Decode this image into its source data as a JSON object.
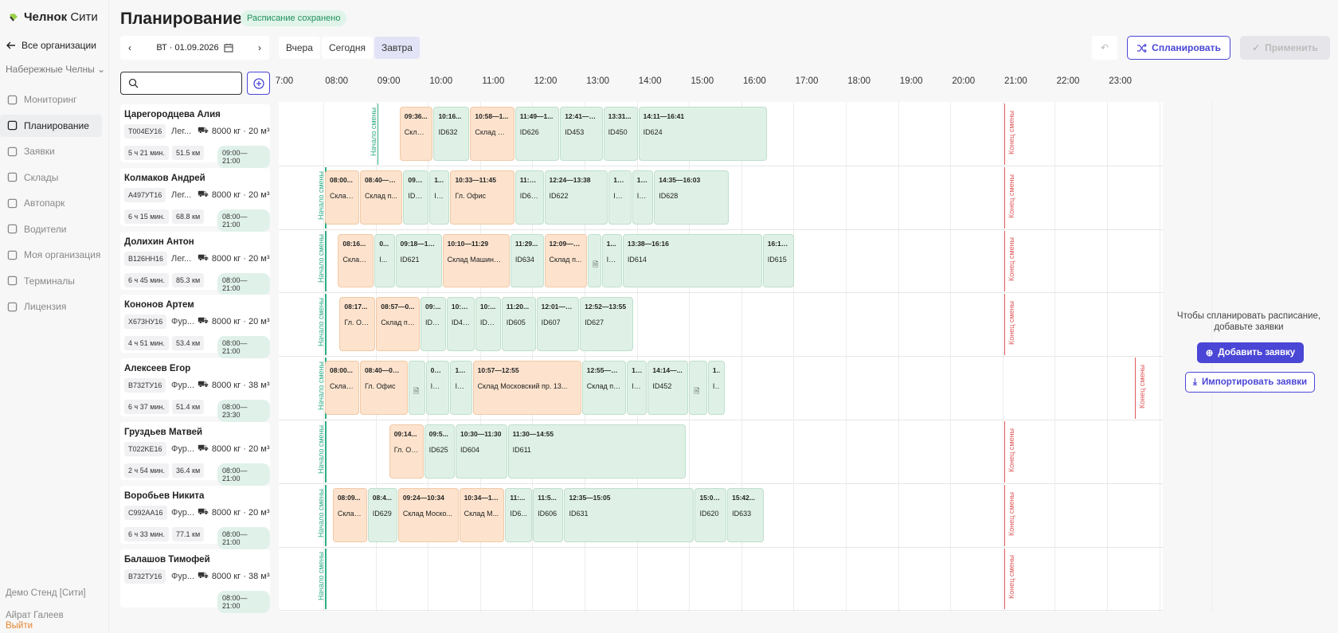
{
  "app": {
    "logo_text": "Челнок",
    "logo_suffix": "Сити",
    "back": "Все организации",
    "city": "Набережные Челны"
  },
  "nav": [
    {
      "label": "Мониторинг",
      "icon": "map-icon"
    },
    {
      "label": "Планирование",
      "icon": "calendar-icon",
      "active": true
    },
    {
      "label": "Заявки",
      "icon": "document-icon"
    },
    {
      "label": "Склады",
      "icon": "warehouse-icon"
    },
    {
      "label": "Автопарк",
      "icon": "truck-icon"
    },
    {
      "label": "Водители",
      "icon": "steering-icon"
    },
    {
      "label": "Моя организация",
      "icon": "gear-icon"
    },
    {
      "label": "Терминалы",
      "icon": "terminal-icon"
    },
    {
      "label": "Лицензия",
      "icon": "license-icon"
    }
  ],
  "footer": {
    "org": "Демо Стенд [Сити]",
    "user": "Айрат Галеев",
    "logout": "Выйти"
  },
  "header": {
    "title": "Планирование",
    "status": "Расписание сохранено",
    "date": "ВТ · 01.09.2026",
    "yesterday": "Вчера",
    "today": "Сегодня",
    "tomorrow": "Завтра",
    "plan": "Спланировать",
    "apply": "Применить"
  },
  "hours": [
    "7:00",
    "08:00",
    "09:00",
    "10:00",
    "11:00",
    "12:00",
    "13:00",
    "14:00",
    "15:00",
    "16:00",
    "17:00",
    "18:00",
    "19:00",
    "20:00",
    "21:00",
    "22:00",
    "23:00"
  ],
  "labels": {
    "start": "Начало смены",
    "end": "Конец смены"
  },
  "drivers": [
    {
      "name": "Царегородцева Алия",
      "plate": "T004EУ16",
      "type": "Лег...",
      "cap": "8000 кг · 20 м³",
      "dur": "5 ч 21 мин.",
      "km": "51.5 км",
      "shift": "09:00—21:00",
      "start": 9,
      "end": 21,
      "blocks": [
        [
          "w",
          9.43,
          10.08,
          "09:36...",
          "Склад..."
        ],
        [
          "g",
          10.08,
          10.78,
          "10:16...",
          "ID632"
        ],
        [
          "w",
          10.78,
          11.64,
          "10:58—1...",
          "Склад М..."
        ],
        [
          "g",
          11.64,
          12.5,
          "11:49—1...",
          "ID626"
        ],
        [
          "g",
          12.5,
          13.33,
          "12:41—1...",
          "ID453"
        ],
        [
          "g",
          13.33,
          14.0,
          "13:31...",
          "ID450"
        ],
        [
          "g",
          14.0,
          16.48,
          "14:11—16:41",
          "ID624"
        ]
      ]
    },
    {
      "name": "Колмаков Андрей",
      "plate": "A497УТ16",
      "type": "Лег...",
      "cap": "8000 кг · 20 м³",
      "dur": "6 ч 15 мин.",
      "km": "68.8 км",
      "shift": "08:00—21:00",
      "start": 8,
      "end": 21,
      "blocks": [
        [
          "w",
          8.0,
          8.67,
          "08:00...",
          "Склад..."
        ],
        [
          "w",
          8.67,
          9.5,
          "08:40—0...",
          "Склад п..."
        ],
        [
          "g",
          9.5,
          10.0,
          "09:29...",
          "ID616"
        ],
        [
          "g",
          10.0,
          10.4,
          "1...",
          "ID..."
        ],
        [
          "w",
          10.4,
          11.64,
          "10:33—11:45",
          "Гл. Офис"
        ],
        [
          "g",
          11.64,
          12.2,
          "11:45...",
          "ID623"
        ],
        [
          "g",
          12.2,
          13.43,
          "12:24—13:38",
          "ID622"
        ],
        [
          "g",
          13.43,
          13.88,
          "13:...",
          "ID4..."
        ],
        [
          "g",
          13.88,
          14.3,
          "14:...",
          "ID..."
        ],
        [
          "g",
          14.3,
          15.75,
          "14:35—16:03",
          "ID628"
        ]
      ]
    },
    {
      "name": "Долихин Антон",
      "plate": "B126HH16",
      "type": "Лег...",
      "cap": "8000 кг · 20 м³",
      "dur": "6 ч 45 мин.",
      "km": "85.3 км",
      "shift": "08:00—21:00",
      "start": 8,
      "end": 21,
      "blocks": [
        [
          "w",
          8.25,
          8.95,
          "08:16...",
          "Склад..."
        ],
        [
          "g",
          8.95,
          9.35,
          "0...",
          "I..."
        ],
        [
          "g",
          9.35,
          10.25,
          "09:18—10...",
          "ID621"
        ],
        [
          "w",
          10.25,
          11.55,
          "10:10—11:29",
          "Склад Машинос..."
        ],
        [
          "g",
          11.55,
          12.2,
          "11:29...",
          "ID634"
        ],
        [
          "w",
          12.2,
          13.03,
          "12:09—1...",
          "Склад п..."
        ],
        [
          "g",
          13.03,
          13.3,
          "",
          "doc"
        ],
        [
          "g",
          13.3,
          13.7,
          "1...",
          "ID..."
        ],
        [
          "g",
          13.7,
          16.38,
          "13:38—16:16",
          "ID614"
        ],
        [
          "g",
          16.38,
          17.0,
          "16:16...",
          "ID615"
        ]
      ]
    },
    {
      "name": "Кононов Артем",
      "plate": "X673HУ16",
      "type": "Фур...",
      "cap": "8000 кг · 20 м³",
      "dur": "4 ч 51 мин.",
      "km": "53.4 км",
      "shift": "08:00—21:00",
      "start": 8,
      "end": 21,
      "blocks": [
        [
          "w",
          8.28,
          8.98,
          "08:17...",
          "Гл. Оф..."
        ],
        [
          "w",
          8.98,
          9.83,
          "08:57—0...",
          "Склад пр..."
        ],
        [
          "g",
          9.83,
          10.33,
          "09:...",
          "ID6..."
        ],
        [
          "g",
          10.33,
          10.88,
          "10:1...",
          "ID451"
        ],
        [
          "g",
          10.88,
          11.38,
          "10:...",
          "ID6..."
        ],
        [
          "g",
          11.38,
          12.05,
          "11:20...",
          "ID605"
        ],
        [
          "g",
          12.05,
          12.88,
          "12:01—1...",
          "ID607"
        ],
        [
          "g",
          12.88,
          13.92,
          "12:52—13:55",
          "ID627"
        ]
      ]
    },
    {
      "name": "Алексеев Егор",
      "plate": "B732TУ16",
      "type": "Фур...",
      "cap": "8000 кг · 38 м³",
      "dur": "6 ч 37 мин.",
      "km": "51.4 км",
      "shift": "08:00—23:30",
      "start": 8,
      "end": 23.5,
      "blocks": [
        [
          "w",
          8.0,
          8.67,
          "08:00...",
          "Склад..."
        ],
        [
          "w",
          8.67,
          9.6,
          "08:40—09:...",
          "Гл. Офис"
        ],
        [
          "g",
          9.6,
          9.93,
          "",
          "doc"
        ],
        [
          "g",
          9.93,
          10.4,
          "09:...",
          "ID4..."
        ],
        [
          "g",
          10.4,
          10.83,
          "10:...",
          "ID6..."
        ],
        [
          "w",
          10.83,
          12.92,
          "10:57—12:55",
          "Склад Московский пр. 13..."
        ],
        [
          "g",
          12.92,
          13.78,
          "12:55—13...",
          "Склад пр..."
        ],
        [
          "g",
          13.78,
          14.18,
          "13...",
          "ID..."
        ],
        [
          "g",
          14.18,
          14.97,
          "14:14—...",
          "ID452"
        ],
        [
          "g",
          14.97,
          15.33,
          "",
          "doc"
        ],
        [
          "g",
          15.33,
          15.67,
          "1...",
          "I..."
        ]
      ]
    },
    {
      "name": "Груздьев Матвей",
      "plate": "T022KE16",
      "type": "Фур...",
      "cap": "8000 кг · 20 м³",
      "dur": "2 ч 54 мин.",
      "km": "36.4 км",
      "shift": "08:00—21:00",
      "start": 8,
      "end": 21,
      "blocks": [
        [
          "w",
          9.23,
          9.9,
          "09:14...",
          "Гл. Оф..."
        ],
        [
          "g",
          9.9,
          10.5,
          "09:5...",
          "ID625"
        ],
        [
          "g",
          10.5,
          11.5,
          "10:30—11:30",
          "ID604"
        ],
        [
          "g",
          11.5,
          14.92,
          "11:30—14:55",
          "ID611"
        ]
      ]
    },
    {
      "name": "Воробьев Никита",
      "plate": "C992AA16",
      "type": "Фур...",
      "cap": "8000 кг · 20 м³",
      "dur": "6 ч 33 мин.",
      "km": "77.1 км",
      "shift": "08:00—21:00",
      "start": 8,
      "end": 21,
      "blocks": [
        [
          "w",
          8.15,
          8.82,
          "08:09...",
          "Склад..."
        ],
        [
          "g",
          8.82,
          9.4,
          "08:4...",
          "ID629"
        ],
        [
          "w",
          9.4,
          10.57,
          "09:24—10:34",
          "Склад Моско..."
        ],
        [
          "w",
          10.57,
          11.45,
          "10:34—11...",
          "Склад М..."
        ],
        [
          "g",
          11.45,
          11.98,
          "11:...",
          "ID6..."
        ],
        [
          "g",
          11.98,
          12.58,
          "11:5...",
          "ID606"
        ],
        [
          "g",
          12.58,
          15.08,
          "12:35—15:05",
          "ID631"
        ],
        [
          "g",
          15.08,
          15.7,
          "15:05...",
          "ID620"
        ],
        [
          "g",
          15.7,
          16.42,
          "15:42...",
          "ID633"
        ]
      ]
    },
    {
      "name": "Балашов Тимофей",
      "plate": "B732TУ16",
      "type": "Фур...",
      "cap": "8000 кг · 38 м³",
      "dur": "",
      "km": "",
      "shift": "08:00—21:00",
      "start": 8,
      "end": 21,
      "blocks": []
    }
  ],
  "empty": {
    "text": "Чтобы спланировать расписание, добавьте заявки",
    "add": "Добавить заявку",
    "import": "Импортировать заявки"
  }
}
